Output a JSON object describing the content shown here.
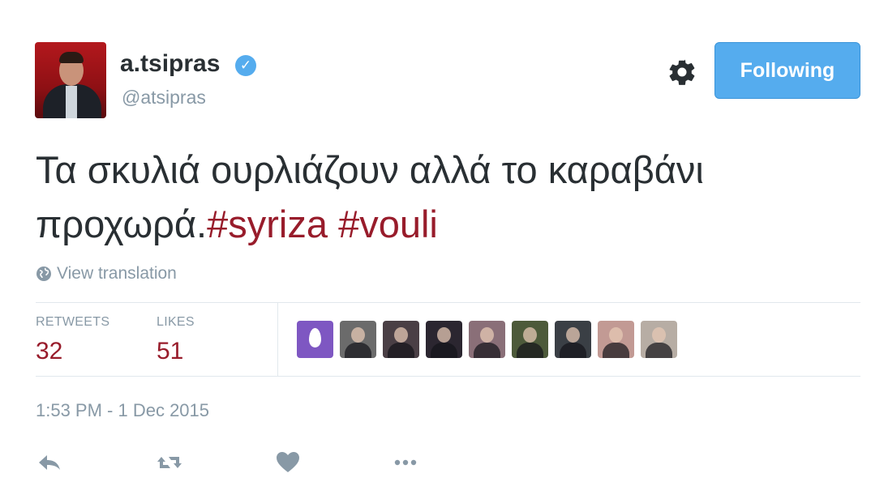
{
  "user": {
    "display_name": "a.tsipras",
    "handle": "@atsipras"
  },
  "follow_button": {
    "label": "Following"
  },
  "tweet": {
    "text": "Τα σκυλιά ουρλιάζουν αλλά το καραβάνι προχωρά.",
    "hashtag_1": "#syriza",
    "hashtag_2": "#vouli"
  },
  "view_translation": {
    "label": "View translation"
  },
  "stats": {
    "retweets_label": "RETWEETS",
    "retweets_count": "32",
    "likes_label": "LIKES",
    "likes_count": "51"
  },
  "likers": [
    {
      "icon": "egg-avatar",
      "color": "#7e57c2"
    },
    {
      "icon": "photo-avatar",
      "color": "#6b6b6b"
    },
    {
      "icon": "photo-avatar",
      "color": "#4a3f45"
    },
    {
      "icon": "photo-avatar",
      "color": "#2b2630"
    },
    {
      "icon": "photo-avatar",
      "color": "#8a6f78"
    },
    {
      "icon": "photo-avatar",
      "color": "#4d5a3a"
    },
    {
      "icon": "photo-avatar",
      "color": "#3a3f45"
    },
    {
      "icon": "photo-avatar",
      "color": "#c29a94"
    },
    {
      "icon": "photo-avatar",
      "color": "#b7ada4"
    }
  ],
  "timestamp": "1:53 PM - 1 Dec 2015",
  "colors": {
    "accent": "#55acee",
    "hashtag": "#981c2b",
    "muted": "#8899a6",
    "text": "#292f33"
  }
}
